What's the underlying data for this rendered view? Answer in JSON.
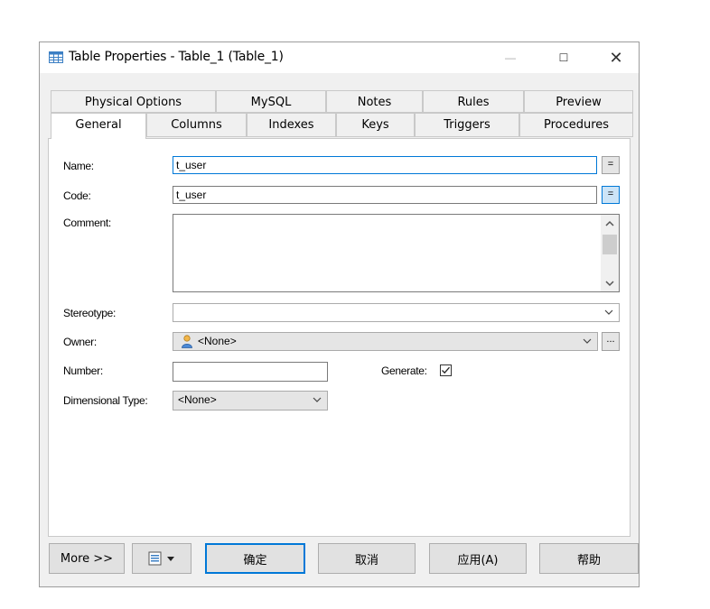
{
  "window": {
    "title": "Table Properties - Table_1 (Table_1)",
    "controls": {
      "minimize": "—",
      "maximize": "☐",
      "close": "✕"
    }
  },
  "tabs_row1": [
    "Physical Options",
    "MySQL",
    "Notes",
    "Rules",
    "Preview"
  ],
  "tabs_row2": [
    "General",
    "Columns",
    "Indexes",
    "Keys",
    "Triggers",
    "Procedures"
  ],
  "active_tab": "General",
  "form": {
    "name_label": "Name:",
    "name_value": "t_user",
    "code_label": "Code:",
    "code_value": "t_user",
    "equals_btn": "=",
    "comment_label": "Comment:",
    "comment_value": "",
    "stereotype_label": "Stereotype:",
    "stereotype_value": "",
    "owner_label": "Owner:",
    "owner_value": "<None>",
    "ellipsis_btn": "...",
    "number_label": "Number:",
    "number_value": "",
    "generate_label": "Generate:",
    "generate_checked": true,
    "dimensional_label": "Dimensional Type:",
    "dimensional_value": "<None>"
  },
  "buttons": {
    "more": "More >>",
    "ok": "确定",
    "cancel": "取消",
    "apply": "应用(A)",
    "help": "帮助"
  },
  "icons": [
    "table-icon",
    "user-icon",
    "print-menu-icon",
    "chevron-down-icon",
    "checkbox-checked-icon"
  ]
}
